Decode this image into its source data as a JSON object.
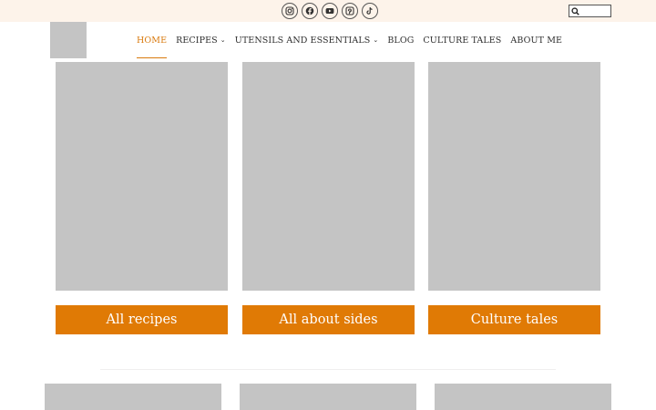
{
  "social_icons": [
    {
      "name": "instagram-icon"
    },
    {
      "name": "facebook-icon"
    },
    {
      "name": "youtube-icon"
    },
    {
      "name": "pinterest-icon"
    },
    {
      "name": "tiktok-icon"
    }
  ],
  "search": {
    "placeholder": "",
    "value": ""
  },
  "nav": {
    "items": [
      {
        "label": "HOME",
        "active": true,
        "dropdown": false
      },
      {
        "label": "RECIPES",
        "active": false,
        "dropdown": true
      },
      {
        "label": "UTENSILS AND ESSENTIALS",
        "active": false,
        "dropdown": true
      },
      {
        "label": "BLOG",
        "active": false,
        "dropdown": false
      },
      {
        "label": "CULTURE TALES",
        "active": false,
        "dropdown": false
      },
      {
        "label": "ABOUT ME",
        "active": false,
        "dropdown": false
      }
    ],
    "dropdown_glyph": "⌄"
  },
  "cards": [
    {
      "button_label": "All recipes"
    },
    {
      "button_label": "All about sides"
    },
    {
      "button_label": "Culture tales"
    }
  ],
  "colors": {
    "accent": "#e07a05",
    "nav_active": "#d97a0e",
    "topbar_bg": "#fdf3ea",
    "placeholder_gray": "#c4c4c4"
  }
}
